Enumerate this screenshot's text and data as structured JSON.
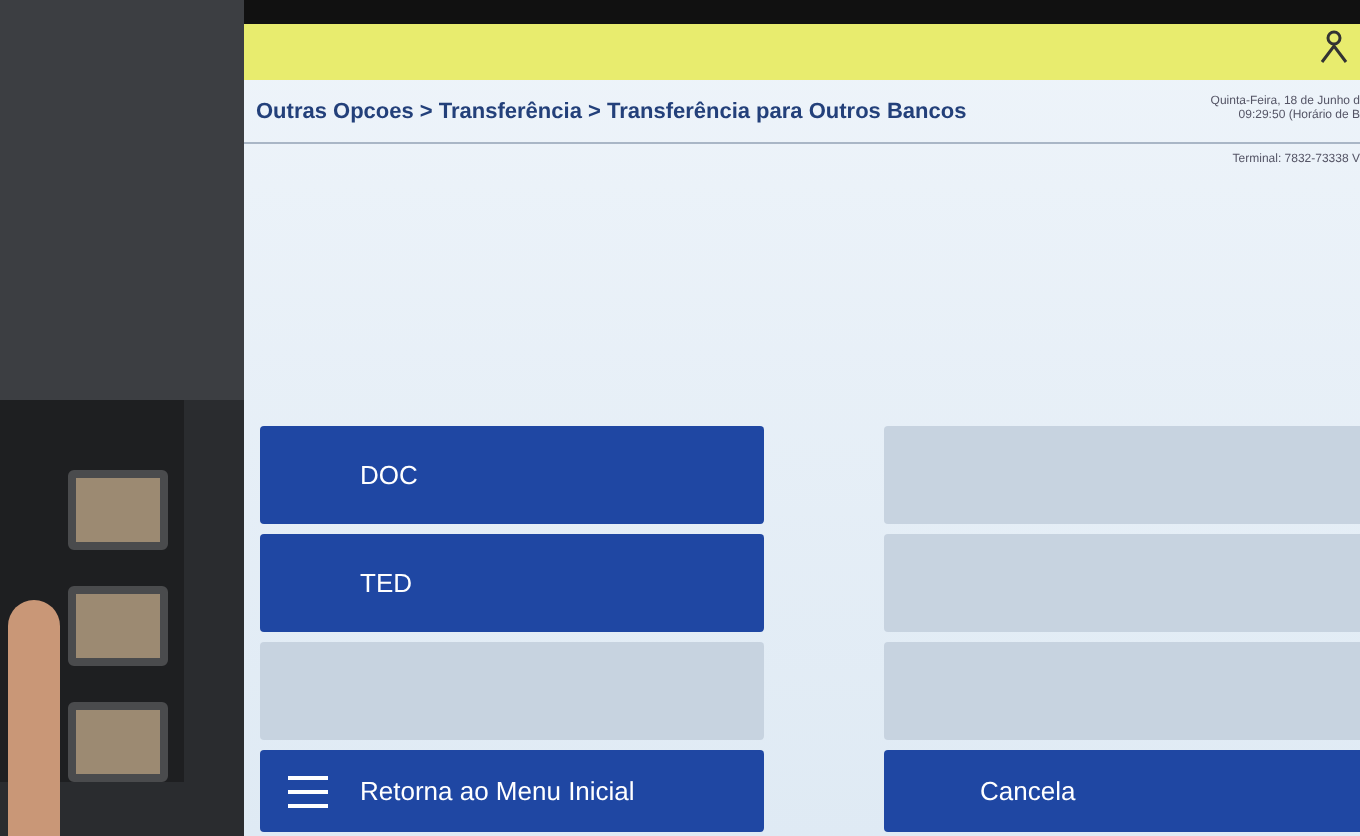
{
  "breadcrumb": "Outras Opcoes > Transferência > Transferência para Outros Bancos",
  "header_info": {
    "date": "Quinta-Feira, 18 de Junho d",
    "time": "09:29:50 (Horário de B",
    "terminal": "Terminal: 7832-73338 V"
  },
  "options_left": [
    {
      "kind": "option",
      "label": "DOC"
    },
    {
      "kind": "option",
      "label": "TED"
    },
    {
      "kind": "blank"
    }
  ],
  "options_right": [
    {
      "kind": "blank"
    },
    {
      "kind": "blank"
    },
    {
      "kind": "blank"
    }
  ],
  "footer_buttons": [
    {
      "kind": "menu",
      "label": "Retorna ao Menu Inicial"
    },
    {
      "kind": "plain",
      "label": "Cancela"
    }
  ]
}
